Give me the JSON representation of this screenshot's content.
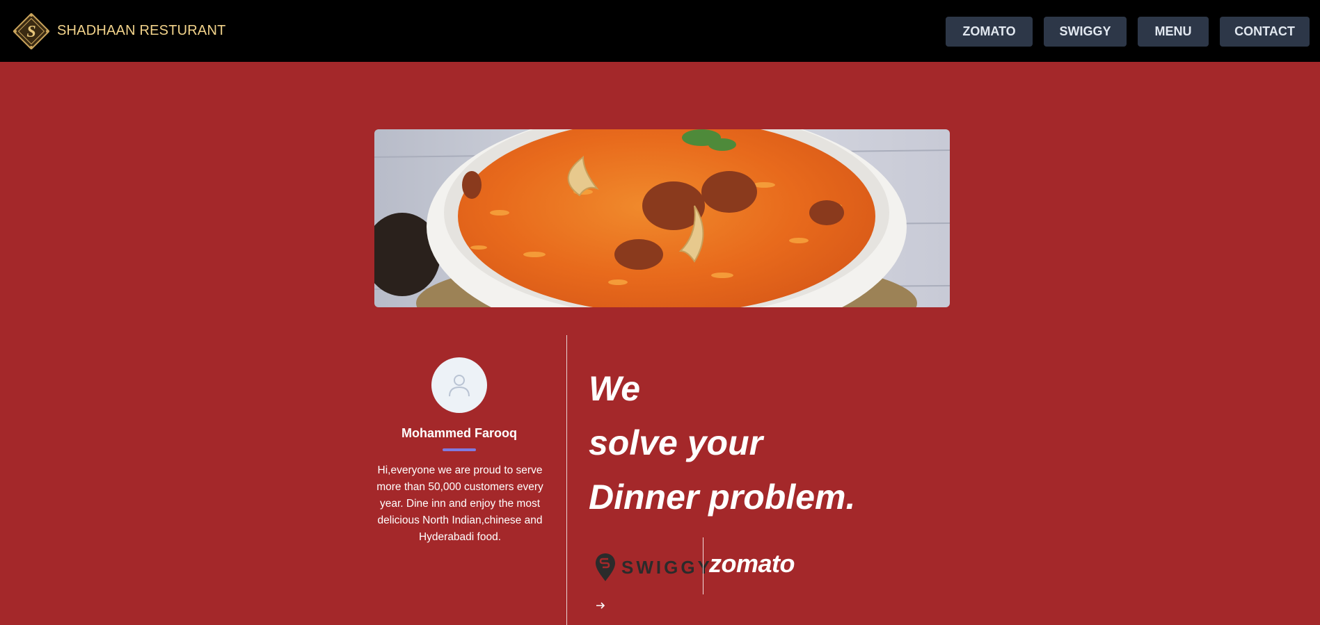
{
  "header": {
    "brand": "SHADHAAN RESTURANT",
    "nav": [
      "ZOMATO",
      "SWIGGY",
      "MENU",
      "CONTACT"
    ]
  },
  "profile": {
    "name": "Mohammed Farooq",
    "bio": "Hi,everyone we are proud to serve more than 50,000 customers every year. Dine inn and enjoy the most delicious North Indian,chinese and Hyderabadi food."
  },
  "headline": {
    "lines": [
      "We",
      "solve your",
      "Dinner problem."
    ]
  },
  "partners": {
    "swiggy": "SWIGGY",
    "zomato": "zomato"
  },
  "colors": {
    "background": "#a4282a",
    "header": "#000000",
    "nav_button": "#2d3748",
    "brand_text": "#f2d38b",
    "accent_underline": "#7f7be0"
  },
  "icons": {
    "logo": "ornamental-s-logo",
    "avatar": "user-icon",
    "arrow": "arrow-right-icon"
  }
}
